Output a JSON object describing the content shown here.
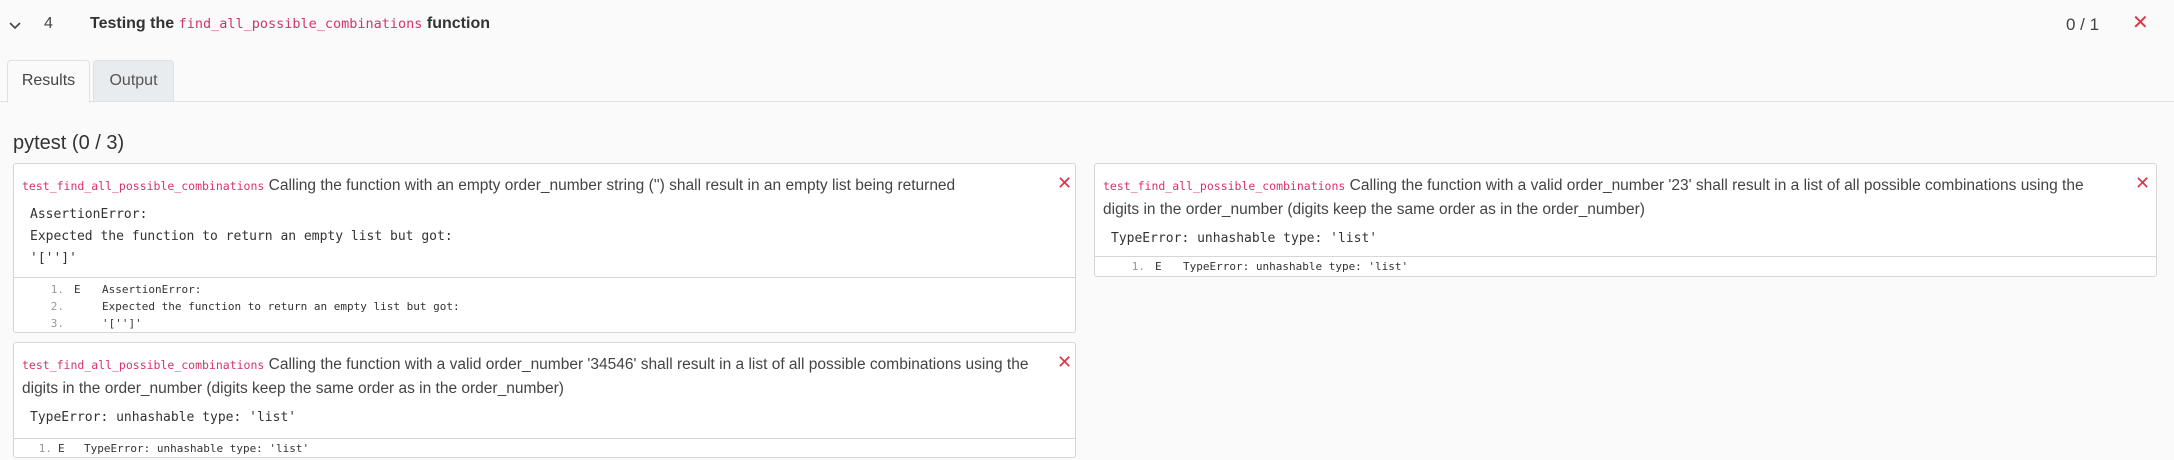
{
  "task": {
    "number": "4",
    "title_prefix": "Testing the",
    "title_code": "find_all_possible_combinations",
    "title_suffix": "function",
    "score": "0 / 1",
    "status_color": "#dc3545"
  },
  "tabs": [
    {
      "label": "Results",
      "active": true
    },
    {
      "label": "Output",
      "active": false
    }
  ],
  "section": {
    "title": "pytest (0 / 3)"
  },
  "tests": [
    {
      "name": "test_find_all_possible_combinations",
      "description": "Calling the function with an empty order_number string ('') shall result in an empty list being returned",
      "message_lines": [
        "AssertionError:",
        "Expected the function to return an empty list but got:",
        "'['']'"
      ],
      "trace": [
        {
          "num": "1.",
          "mark": "E",
          "text": "AssertionError:"
        },
        {
          "num": "2.",
          "mark": "",
          "text": "Expected the function to return an empty list but got:"
        },
        {
          "num": "3.",
          "mark": "",
          "text": "'['']'"
        }
      ]
    },
    {
      "name": "test_find_all_possible_combinations",
      "description_line1": "Calling the function with a valid order_number '23' shall result in a list of all possible combinations using the",
      "description_line2": "digits in the order_number (digits keep the same order as in the order_number)",
      "message_lines": [
        "TypeError: unhashable type: 'list'"
      ],
      "trace": [
        {
          "num": "1.",
          "mark": "E",
          "text": "TypeError: unhashable type: 'list'"
        }
      ]
    },
    {
      "name": "test_find_all_possible_combinations",
      "description_line1": "Calling the function with a valid order_number '34546' shall result in a list of all possible combinations using the",
      "description_line2": "digits in the order_number (digits keep the same order as in the order_number)",
      "message_lines": [
        "TypeError: unhashable type: 'list'"
      ],
      "trace": [
        {
          "num": "1.",
          "mark": "E",
          "text": "TypeError: unhashable type: 'list'"
        }
      ]
    }
  ],
  "icons": {
    "collapse": "chevron-down-icon",
    "fail": "close-icon"
  }
}
